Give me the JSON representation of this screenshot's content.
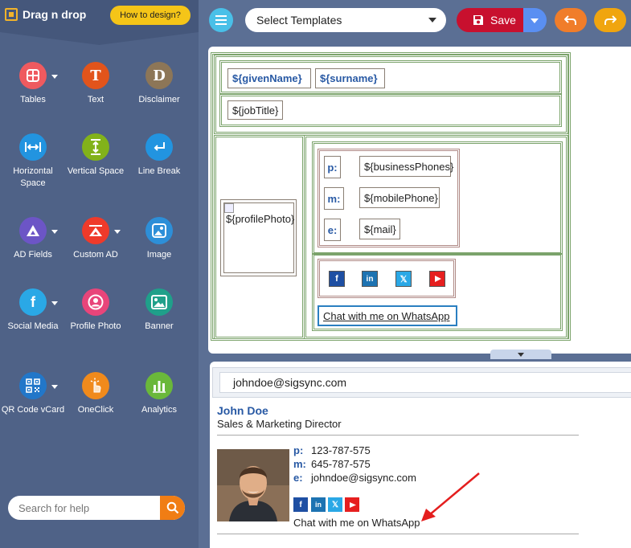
{
  "sidebar": {
    "logo": "Drag n drop",
    "how_to": "How to design?",
    "tools": [
      {
        "label": "Tables",
        "icon": "table-icon",
        "color": "#ef5a5f"
      },
      {
        "label": "Text",
        "icon": "text-icon",
        "glyph": "T",
        "color": "#e2541b"
      },
      {
        "label": "Disclaimer",
        "icon": "disclaimer-icon",
        "glyph": "D",
        "color": "#8d7657"
      },
      {
        "label": "Horizontal Space",
        "icon": "horizontal-space-icon",
        "color": "#2294e0"
      },
      {
        "label": "Vertical Space",
        "icon": "vertical-space-icon",
        "color": "#82b21a"
      },
      {
        "label": "Line Break",
        "icon": "line-break-icon",
        "color": "#2294e0"
      },
      {
        "label": "AD Fields",
        "icon": "ad-fields-icon",
        "color": "#6c55c6"
      },
      {
        "label": "Custom AD",
        "icon": "custom-ad-icon",
        "color": "#ef3a2a"
      },
      {
        "label": "Image",
        "icon": "image-icon",
        "color": "#2d8fd8"
      },
      {
        "label": "Social Media",
        "icon": "social-media-icon",
        "glyph": "f",
        "color": "#2aa8e6"
      },
      {
        "label": "Profile Photo",
        "icon": "profile-photo-icon",
        "color": "#e8457a"
      },
      {
        "label": "Banner",
        "icon": "banner-icon",
        "color": "#1fa08a"
      },
      {
        "label": "QR Code vCard",
        "icon": "qr-code-icon",
        "color": "#2277c9"
      },
      {
        "label": "OneClick",
        "icon": "oneclick-icon",
        "color": "#f08a1c"
      },
      {
        "label": "Analytics",
        "icon": "analytics-icon",
        "color": "#6ab83a"
      }
    ],
    "search_placeholder": "Search for help"
  },
  "toolbar": {
    "template_select": "Select Templates",
    "save_label": "Save"
  },
  "editor": {
    "given_name": "${givenName}",
    "surname": "${surname}",
    "job_title": "${jobTitle}",
    "profile_photo": "${profilePhoto}",
    "phone_label": "p:",
    "phone_value": "${businessPhones}",
    "mobile_label": "m:",
    "mobile_value": "${mobilePhone}",
    "email_label": "e:",
    "email_value": "${mail}",
    "whatsapp": "Chat with me on WhatsApp"
  },
  "preview": {
    "email": "johndoe@sigsync.com",
    "name": "John Doe",
    "title": "Sales & Marketing Director",
    "phone_label": "p:",
    "phone": "123-787-575",
    "mobile_label": "m:",
    "mobile": "645-787-575",
    "email_label": "e:",
    "email_value": "johndoe@sigsync.com",
    "whatsapp": "Chat with me on WhatsApp"
  },
  "colors": {
    "save": "#c8102e",
    "undo": "#f07d2a",
    "redo": "#f0a50f",
    "accent_text": "#2859a4",
    "facebook": "#1e4fa3",
    "linkedin": "#1d73b2",
    "x": "#2aa8e6",
    "youtube": "#e61f1f"
  }
}
